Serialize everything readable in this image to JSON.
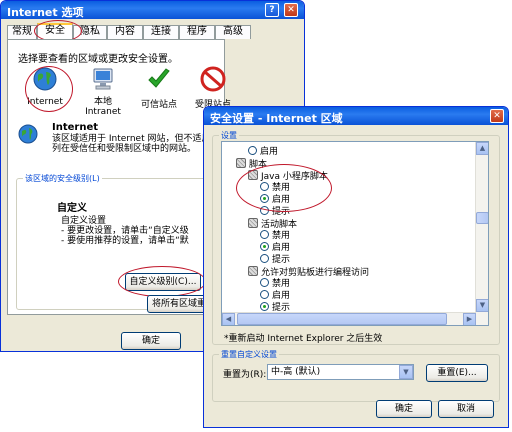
{
  "ie_options": {
    "title": "Internet 选项",
    "tabs": [
      "常规",
      "安全",
      "隐私",
      "内容",
      "连接",
      "程序",
      "高级"
    ],
    "zone_prompt": "选择要查看的区域或更改安全设置。",
    "zones": [
      {
        "label": "Internet",
        "icon": "globe-icon"
      },
      {
        "label": "本地\nIntranet",
        "icon": "computer-icon"
      },
      {
        "label": "可信站点",
        "icon": "check-icon"
      },
      {
        "label": "受限站点",
        "icon": "no-entry-icon"
      }
    ],
    "zone_title": "Internet",
    "zone_desc": "该区域适用于 Internet 网站，但不适用于列在受信任和受限制区域中的网站。",
    "security_level_title": "该区域的安全级别(L)",
    "custom_title": "自定义",
    "custom_lines": [
      "自定义设置",
      "- 要更改设置，请单击“自定义级",
      "- 要使用推荐的设置，请单击“默"
    ],
    "custom_level_button": "自定义级别(C)...",
    "reset_all_button": "将所有区域重",
    "ok_button": "确定"
  },
  "security_settings": {
    "title": "安全设置 - Internet 区域",
    "settings_group": "设置",
    "tree": [
      {
        "type": "radio",
        "label": "启用",
        "checked": false,
        "indent": 1
      },
      {
        "type": "gear",
        "label": "脚本",
        "indent": 0
      },
      {
        "type": "gear",
        "label": "Java 小程序脚本",
        "indent": 1
      },
      {
        "type": "radio",
        "label": "禁用",
        "checked": false,
        "indent": 2
      },
      {
        "type": "radio",
        "label": "启用",
        "checked": true,
        "indent": 2
      },
      {
        "type": "radio",
        "label": "提示",
        "checked": false,
        "indent": 2
      },
      {
        "type": "gear",
        "label": "活动脚本",
        "indent": 1
      },
      {
        "type": "radio",
        "label": "禁用",
        "checked": false,
        "indent": 2
      },
      {
        "type": "radio",
        "label": "启用",
        "checked": true,
        "indent": 2
      },
      {
        "type": "radio",
        "label": "提示",
        "checked": false,
        "indent": 2
      },
      {
        "type": "gear",
        "label": "允许对剪贴板进行编程访问",
        "indent": 1
      },
      {
        "type": "radio",
        "label": "禁用",
        "checked": false,
        "indent": 2
      },
      {
        "type": "radio",
        "label": "启用",
        "checked": false,
        "indent": 2
      },
      {
        "type": "radio",
        "label": "提示",
        "checked": true,
        "indent": 2
      }
    ],
    "restart_note": "*重新启动 Internet Explorer 之后生效",
    "reset_group": "重置自定义设置",
    "reset_label": "重置为(R):",
    "reset_value": "中-高 (默认)",
    "reset_button": "重置(E)...",
    "ok_button": "确定",
    "cancel_button": "取消"
  }
}
